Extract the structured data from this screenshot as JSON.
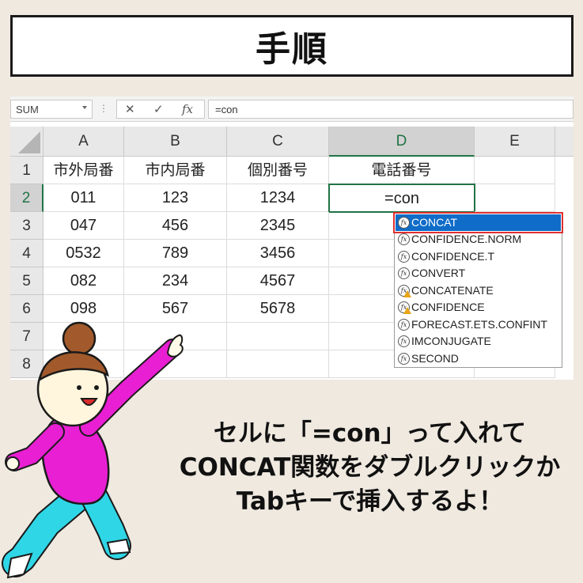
{
  "banner": {
    "title": "手順"
  },
  "formula_bar": {
    "name_box": "SUM",
    "cancel_icon": "✕",
    "enter_icon": "✓",
    "fx_icon": "fx",
    "formula": "=con"
  },
  "columns": [
    "A",
    "B",
    "C",
    "D",
    "E"
  ],
  "rows": [
    "1",
    "2",
    "3",
    "4",
    "5",
    "6",
    "7",
    "8"
  ],
  "cells": [
    [
      "市外局番",
      "市内局番",
      "個別番号",
      "電話番号"
    ],
    [
      "011",
      "123",
      "1234",
      "=con"
    ],
    [
      "047",
      "456",
      "2345",
      ""
    ],
    [
      "0532",
      "789",
      "3456",
      ""
    ],
    [
      "082",
      "234",
      "4567",
      ""
    ],
    [
      "098",
      "567",
      "5678",
      ""
    ]
  ],
  "autocomplete": {
    "items": [
      "CONCAT",
      "CONFIDENCE.NORM",
      "CONFIDENCE.T",
      "CONVERT",
      "CONCATENATE",
      "CONFIDENCE",
      "FORECAST.ETS.CONFINT",
      "IMCONJUGATE",
      "SECOND"
    ],
    "selected_index": 0,
    "warning_items": [
      4,
      5
    ]
  },
  "caption": {
    "line1": "セルに「=con」って入れて",
    "line2": "CONCAT関数をダブルクリックか",
    "line3": "Tabキーで挿入するよ！"
  },
  "colors": {
    "excel_green": "#217346",
    "selection_blue": "#0f6cc8",
    "highlight_red": "#e03030",
    "character_shirt": "#e81fd2",
    "character_pants": "#2fd6e6"
  }
}
